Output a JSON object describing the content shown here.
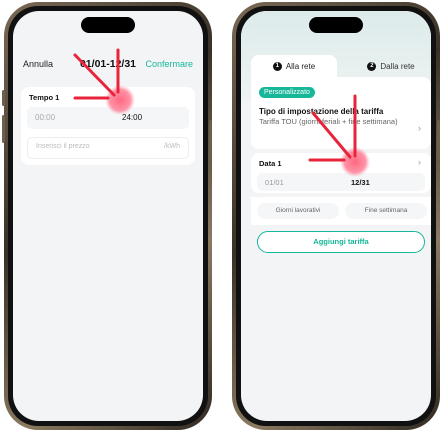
{
  "left_screen": {
    "header": {
      "cancel_label": "Annulla",
      "range_label": "01/01-12/31",
      "confirm_label": "Confermare"
    },
    "period": {
      "title": "Tempo 1",
      "start_value": "00:00",
      "end_value": "24:00",
      "price_placeholder": "Inserisci il prezzo",
      "price_unit": "/kWh"
    }
  },
  "right_screen": {
    "tabs": [
      {
        "number": "1",
        "label": "Alla rete"
      },
      {
        "number": "2",
        "label": "Dalla rete"
      }
    ],
    "mode_badge": "Personalizzato",
    "tariff_type_title": "Tipo di impostazione della tariffa",
    "tariff_type_value": "Tariffa TOU (giorni feriali + fine settimana)",
    "date_section": {
      "title": "Data 1",
      "start_value": "01/01",
      "end_value": "12/31"
    },
    "day_options": [
      "Giorni lavorativi",
      "Fine settimana"
    ],
    "add_button_label": "Aggiungi tariffa"
  },
  "colors": {
    "accent": "#17b79a",
    "annotation_arrow": "#e8233a",
    "tap_indicator": "#ff5f7a"
  }
}
